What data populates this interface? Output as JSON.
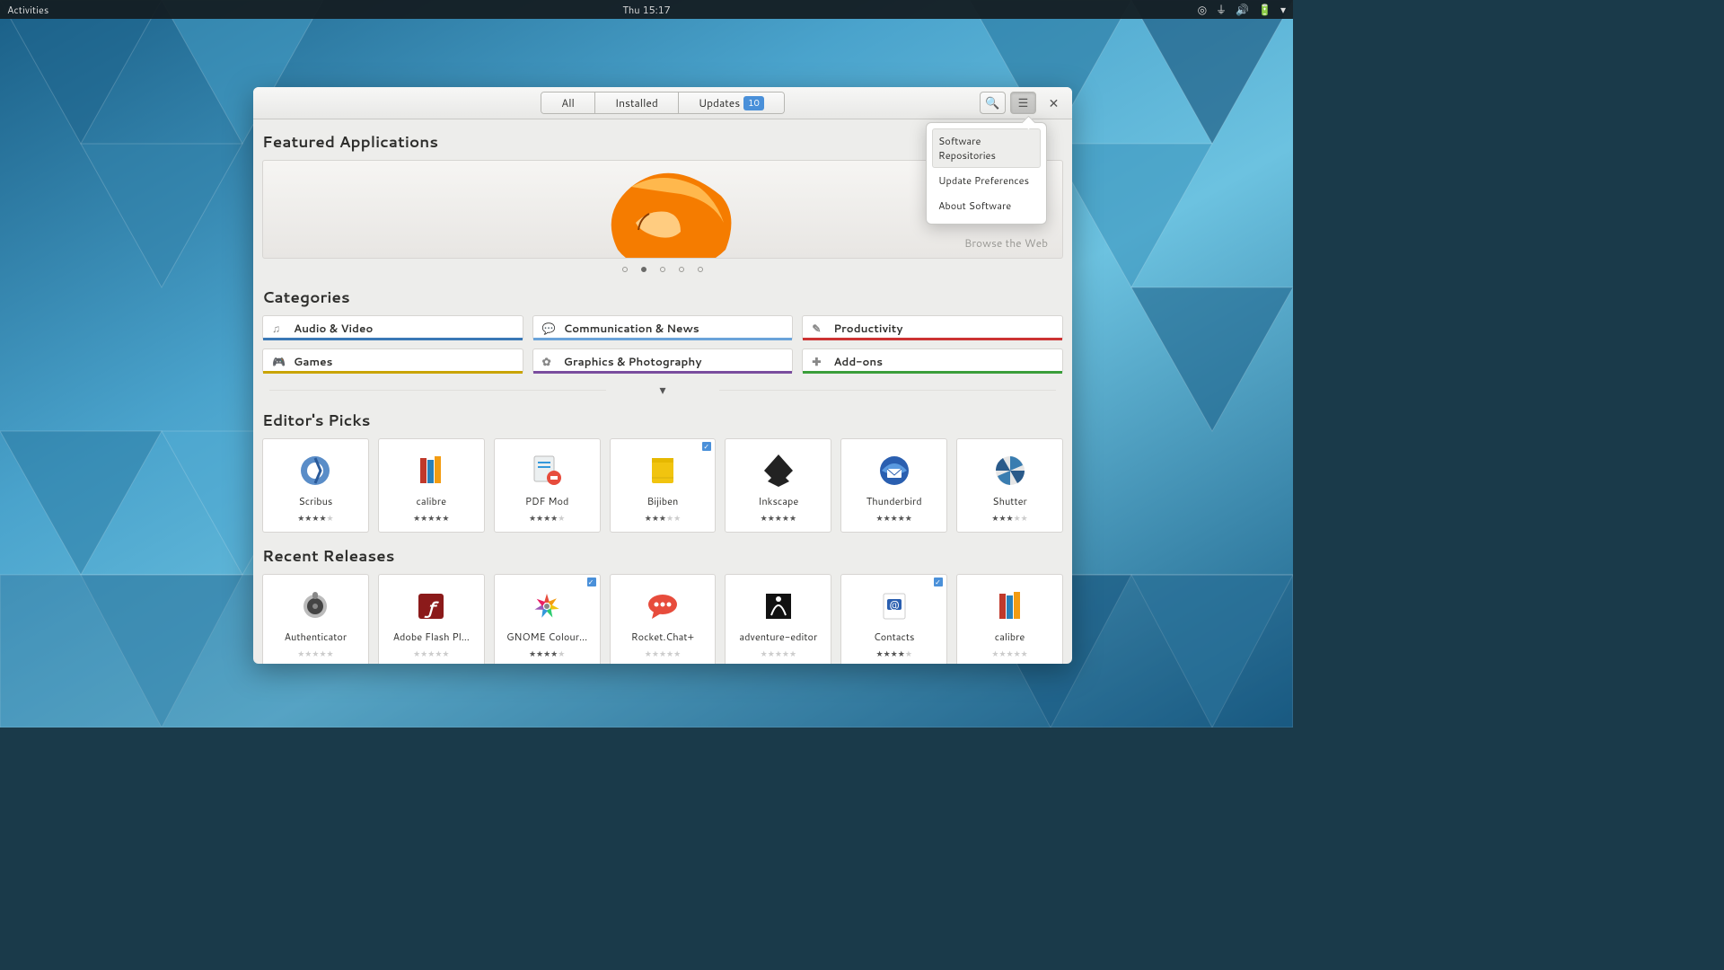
{
  "topbar": {
    "activities": "Activities",
    "clock": "Thu 15:17"
  },
  "titlebar": {
    "tabs": {
      "all": "All",
      "installed": "Installed",
      "updates": "Updates",
      "updates_badge": "10"
    }
  },
  "popover": {
    "repos": "Software Repositories",
    "prefs": "Update Preferences",
    "about": "About Software"
  },
  "featured": {
    "title": "Featured Applications",
    "caption": "Browse the Web"
  },
  "categories": {
    "title": "Categories",
    "items": [
      {
        "label": "Audio & Video",
        "icon": "♫",
        "color": "#3a78b6"
      },
      {
        "label": "Communication & News",
        "icon": "💬",
        "color": "#6aa3d9"
      },
      {
        "label": "Productivity",
        "icon": "✎",
        "color": "#cc3333"
      },
      {
        "label": "Games",
        "icon": "🎮",
        "color": "#c9a400"
      },
      {
        "label": "Graphics & Photography",
        "icon": "✿",
        "color": "#7a4d9e"
      },
      {
        "label": "Add-ons",
        "icon": "✚",
        "color": "#3a9e3a"
      }
    ]
  },
  "picks": {
    "title": "Editor's Picks",
    "apps": [
      {
        "name": "Scribus",
        "rating": 4,
        "icon": "scribus"
      },
      {
        "name": "calibre",
        "rating": 5,
        "icon": "calibre"
      },
      {
        "name": "PDF Mod",
        "rating": 4,
        "icon": "pdfmod"
      },
      {
        "name": "Bijiben",
        "rating": 3,
        "icon": "bijiben",
        "checked": true
      },
      {
        "name": "Inkscape",
        "rating": 5,
        "icon": "inkscape"
      },
      {
        "name": "Thunderbird",
        "rating": 5,
        "icon": "thunderbird"
      },
      {
        "name": "Shutter",
        "rating": 3,
        "icon": "shutter"
      }
    ]
  },
  "recent": {
    "title": "Recent Releases",
    "apps": [
      {
        "name": "Authenticator",
        "rating": 0,
        "icon": "authenticator"
      },
      {
        "name": "Adobe Flash Pl…",
        "rating": 0,
        "icon": "flash"
      },
      {
        "name": "GNOME Colour…",
        "rating": 4,
        "icon": "gnomecolour",
        "checked": true
      },
      {
        "name": "Rocket.Chat+",
        "rating": 0,
        "icon": "rocketchat"
      },
      {
        "name": "adventure-editor",
        "rating": 0,
        "icon": "adventure"
      },
      {
        "name": "Contacts",
        "rating": 4,
        "icon": "contacts",
        "checked": true
      },
      {
        "name": "calibre",
        "rating": 0,
        "icon": "calibre"
      }
    ]
  }
}
